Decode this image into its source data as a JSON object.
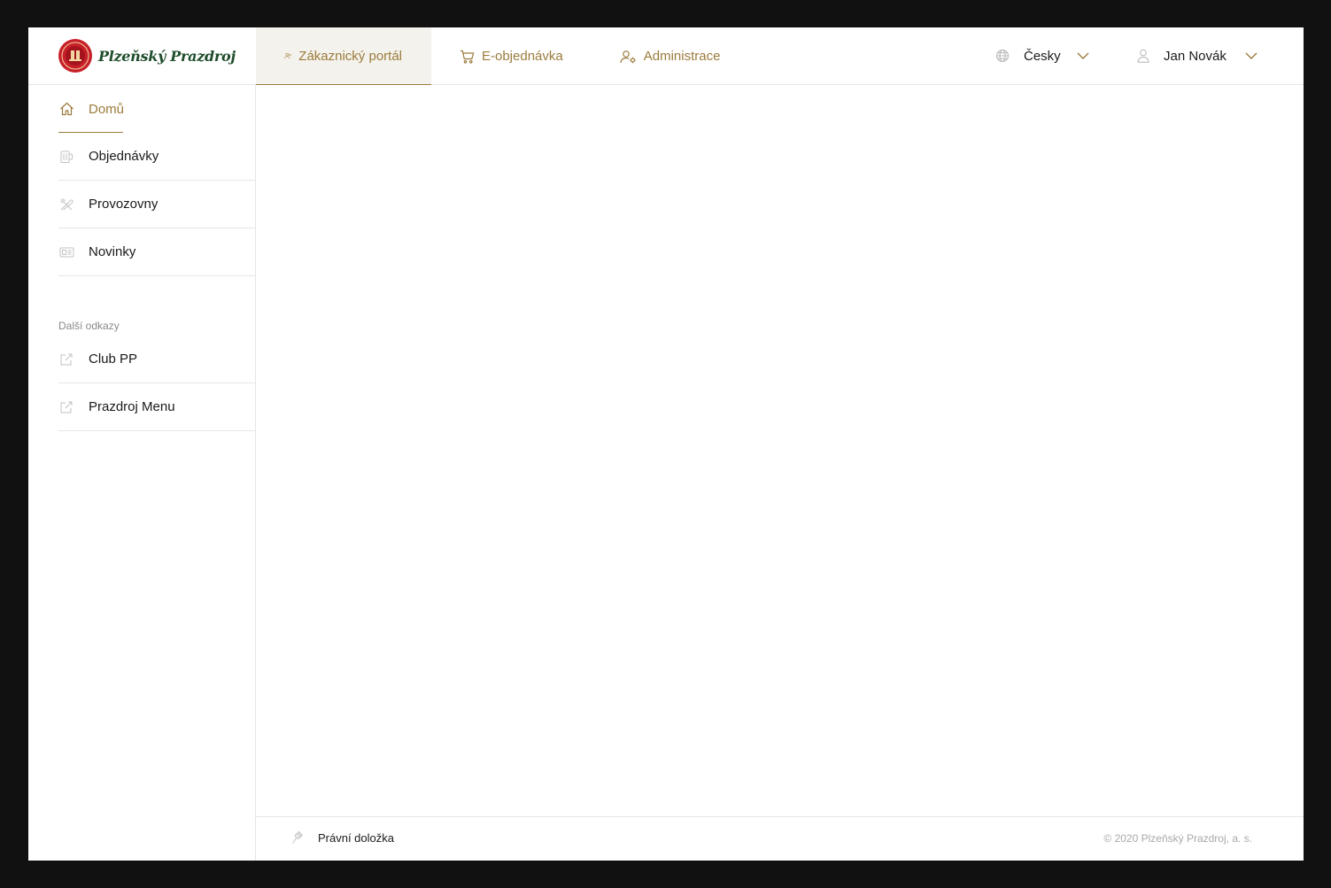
{
  "header": {
    "logo_text": "Plzeňský Prazdroj",
    "tabs": [
      {
        "label": "Zákaznický portál",
        "icon": "user-plus-icon",
        "active": true
      },
      {
        "label": "E-objednávka",
        "icon": "cart-icon",
        "active": false
      },
      {
        "label": "Administrace",
        "icon": "user-gear-icon",
        "active": false
      }
    ],
    "language": {
      "label": "Česky",
      "icon": "globe-icon"
    },
    "user": {
      "name": "Jan Novák",
      "icon": "user-icon"
    }
  },
  "sidebar": {
    "items": [
      {
        "label": "Domů",
        "icon": "home-icon",
        "active": true
      },
      {
        "label": "Objednávky",
        "icon": "beer-mug-icon",
        "active": false
      },
      {
        "label": "Provozovny",
        "icon": "cutlery-icon",
        "active": false
      },
      {
        "label": "Novinky",
        "icon": "newspaper-icon",
        "active": false
      }
    ],
    "section_title": "Další odkazy",
    "links": [
      {
        "label": "Club PP",
        "icon": "external-link-icon"
      },
      {
        "label": "Prazdroj Menu",
        "icon": "external-link-icon"
      }
    ]
  },
  "footer": {
    "legal_label": "Právní doložka",
    "legal_icon": "gavel-icon",
    "copyright": "© 2020 Plzeňský Prazdroj, a. s."
  },
  "colors": {
    "accent": "#9b7b3c",
    "active_tab_bg": "#f4f2ec",
    "logo_red": "#c8202a",
    "logo_green": "#1f4d2b"
  }
}
